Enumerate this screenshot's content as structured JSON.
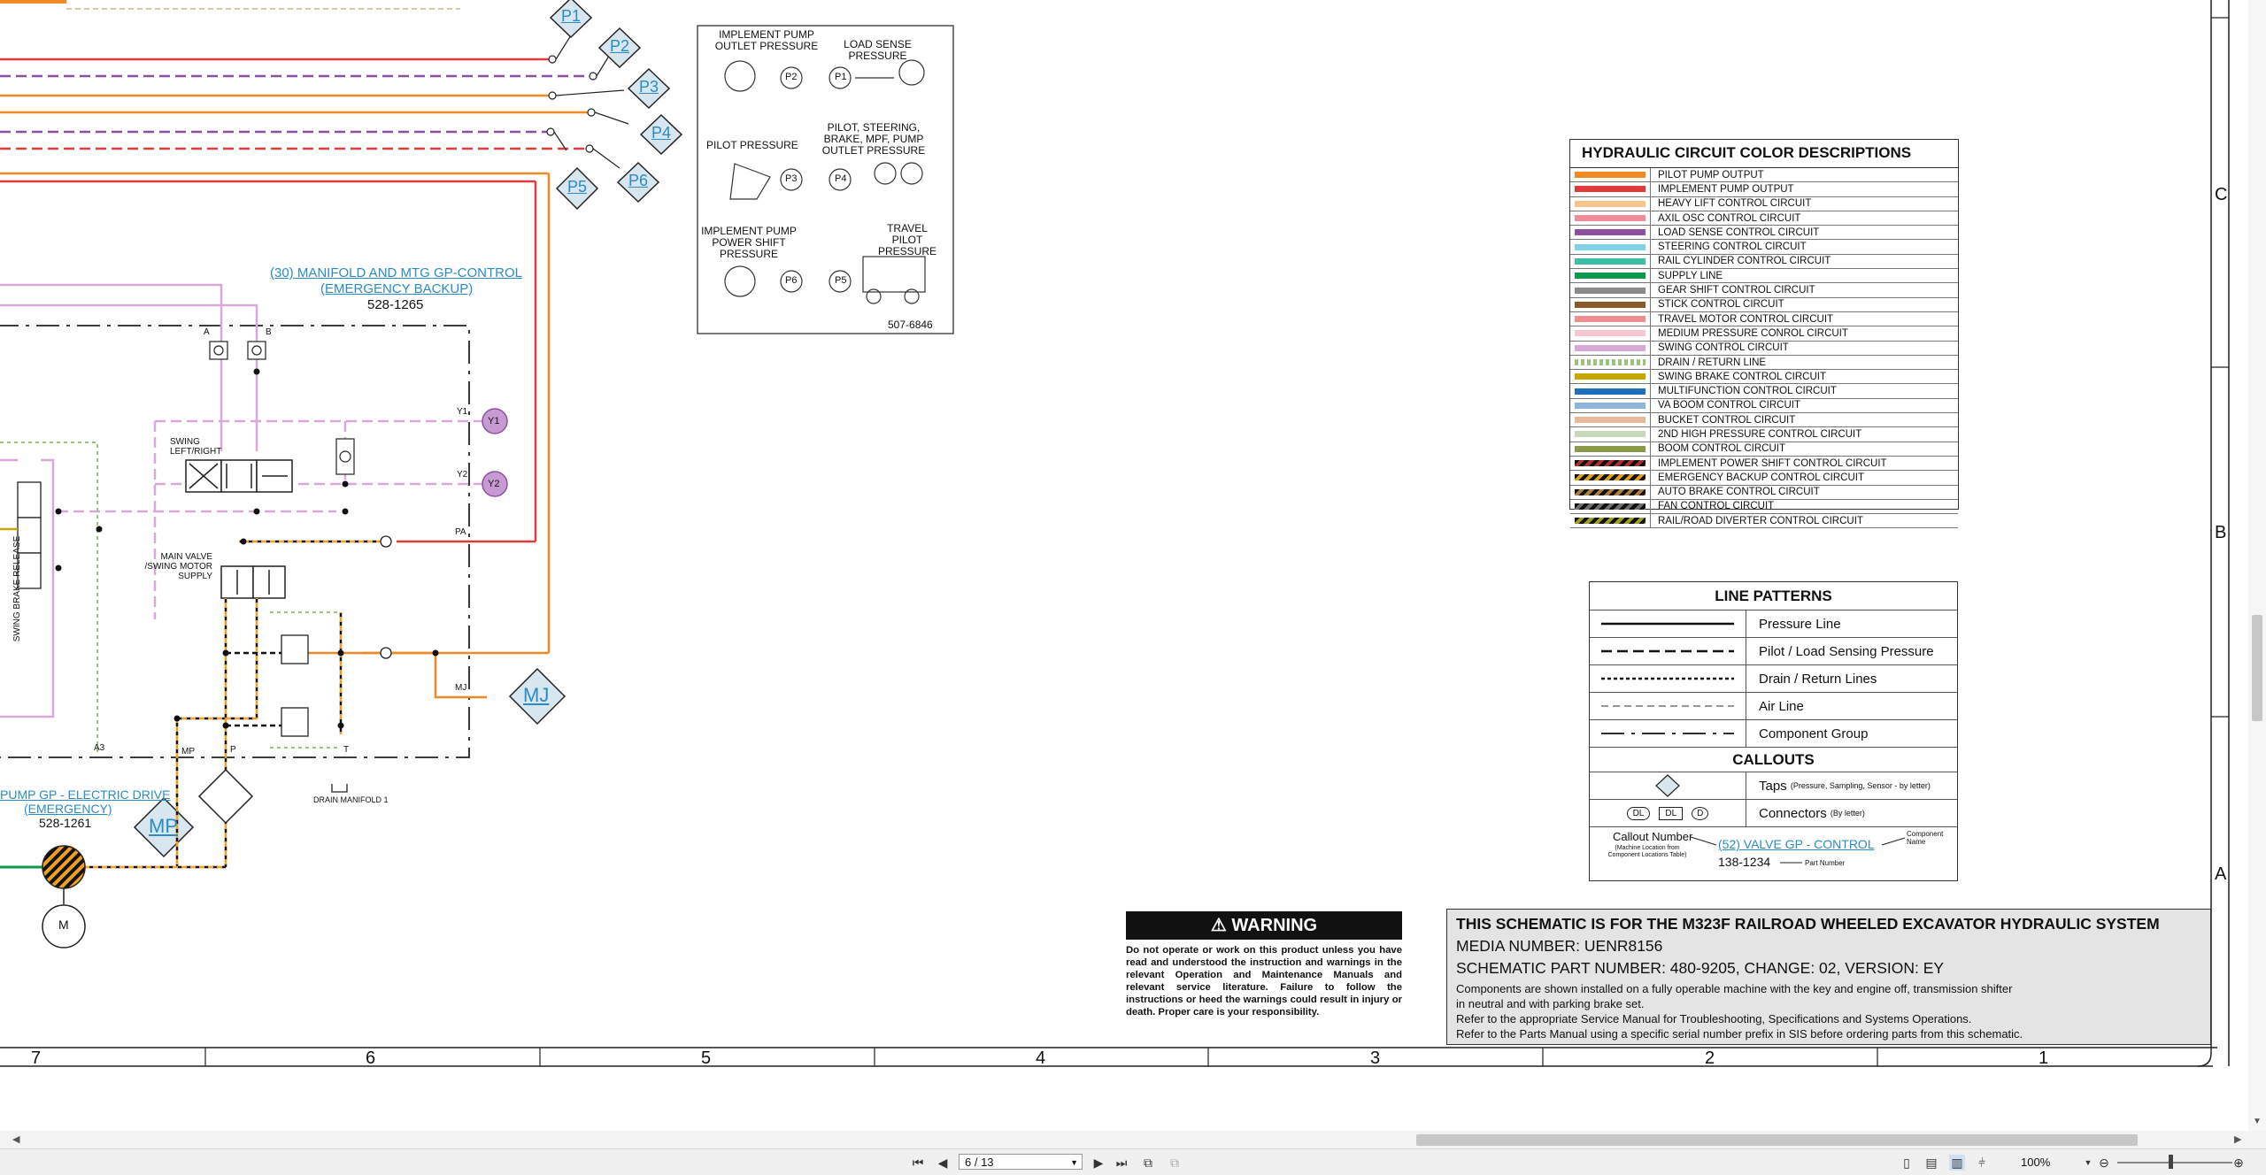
{
  "taps": {
    "p1": "P1",
    "p2": "P2",
    "p3": "P3",
    "p4": "P4",
    "p5": "P5",
    "p6": "P6",
    "mj": "MJ",
    "mp": "MP"
  },
  "pressure_key": {
    "implement_pump_outlet": "IMPLEMENT PUMP OUTLET PRESSURE",
    "load_sense": "LOAD SENSE PRESSURE",
    "pilot": "PILOT PRESSURE",
    "pilot_steering": "PILOT, STEERING, BRAKE, MPF, PUMP OUTLET PRESSURE",
    "implement_power_shift": "IMPLEMENT PUMP POWER SHIFT PRESSURE",
    "travel_pilot": "TRAVEL PILOT PRESSURE",
    "part_number": "507-6846"
  },
  "components": {
    "manifold_link_1": "(30) MANIFOLD AND MTG GP-CONTROL",
    "manifold_link_2": "(EMERGENCY BACKUP)",
    "manifold_part": "528-1265",
    "pump_link_1": "PUMP GP - ELECTRIC DRIVE",
    "pump_link_2": "(EMERGENCY)",
    "pump_part": "528-1261",
    "swing_valve": "SWING LEFT/RIGHT",
    "main_valve": "MAIN VALVE /SWING MOTOR SUPPLY",
    "swing_brake_release": "SWING BRAKE RELEASE",
    "drain_manifold": "DRAIN MANIFOLD 1",
    "motor": "M",
    "port_a": "A",
    "port_b": "B",
    "port_y1": "Y1",
    "port_y2": "Y2",
    "port_pa": "PA",
    "port_mj": "MJ",
    "port_mp": "MP",
    "port_p": "P",
    "port_t": "T",
    "port_a3": "A3"
  },
  "legend": {
    "title": "HYDRAULIC CIRCUIT COLOR DESCRIPTIONS",
    "items": [
      {
        "label": "PILOT PUMP OUTPUT",
        "color": "#f08a24"
      },
      {
        "label": "IMPLEMENT PUMP OUTPUT",
        "color": "#e03a3a"
      },
      {
        "label": "HEAVY LIFT CONTROL CIRCUIT",
        "color": "#f6c48c"
      },
      {
        "label": "AXIL OSC CONTROL CIRCUIT",
        "color": "#f28b9a"
      },
      {
        "label": "LOAD SENSE CONTROL CIRCUIT",
        "color": "#8e4fa0"
      },
      {
        "label": "STEERING CONTROL CIRCUIT",
        "color": "#7fd3e8"
      },
      {
        "label": "RAIL CYLINDER CONTROL CIRCUIT",
        "color": "#3cbfa6"
      },
      {
        "label": "SUPPLY LINE",
        "color": "#0e9a4c"
      },
      {
        "label": "GEAR SHIFT CONTROL CIRCUIT",
        "color": "#8a8a8a"
      },
      {
        "label": "STICK CONTROL CIRCUIT",
        "color": "#8b5a2b"
      },
      {
        "label": "TRAVEL MOTOR CONTROL CIRCUIT",
        "color": "#ee8f8f"
      },
      {
        "label": "MEDIUM PRESSURE CONROL CIRCUIT",
        "color": "#f7c6cf"
      },
      {
        "label": "SWING CONTROL CIRCUIT",
        "color": "#d8a8d8"
      },
      {
        "label": "DRAIN / RETURN LINE",
        "color": "#9ac47a"
      },
      {
        "label": "SWING BRAKE CONTROL CIRCUIT",
        "color": "#c8a800"
      },
      {
        "label": "MULTIFUNCTION CONTROL CIRCUIT",
        "color": "#1c6fb8"
      },
      {
        "label": "VA BOOM CONTROL CIRCUIT",
        "color": "#8fb4dc"
      },
      {
        "label": "BUCKET CONTROL CIRCUIT",
        "color": "#e8b89a"
      },
      {
        "label": "2ND HIGH PRESSURE CONTROL CIRCUIT",
        "color": "#c8d8b8"
      },
      {
        "label": "BOOM CONTROL CIRCUIT",
        "color": "#8a9a4a"
      },
      {
        "label": "IMPLEMENT POWER SHIFT CONTROL CIRCUIT",
        "color": "#b03030"
      },
      {
        "label": "EMERGENCY BACKUP CONTROL CIRCUIT",
        "color": "#e0a020"
      },
      {
        "label": "AUTO BRAKE CONTROL CIRCUIT",
        "color": "#b08040"
      },
      {
        "label": "FAN CONTROL CIRCUIT",
        "color": "#707070"
      },
      {
        "label": "RAIL/ROAD DIVERTER CONTROL CIRCUIT",
        "color": "#a0a020"
      }
    ]
  },
  "patterns": {
    "title": "LINE PATTERNS",
    "pressure": "Pressure Line",
    "pilot": "Pilot / Load Sensing Pressure",
    "drain": "Drain / Return Lines",
    "air": "Air Line",
    "group": "Component Group",
    "callouts_title": "CALLOUTS",
    "taps": "Taps",
    "taps_note": "(Pressure, Sampling, Sensor - by letter)",
    "connectors": "Connectors",
    "connectors_note": "(By letter)",
    "tap_symbol": "YY",
    "conn_dl": "DL",
    "conn_d": "D",
    "callout_number": "Callout Number",
    "callout_note": "(Machine Location from Component Locations Table)",
    "example_link": "(52) VALVE GP - CONTROL",
    "component_name": "Component Name",
    "example_part": "138-1234",
    "part_number": "Part Number"
  },
  "warning": {
    "header": "WARNING",
    "body": "Do not operate or work on this product unless you have read and understood the instruction and warnings in the relevant Operation and Maintenance Manuals and relevant service literature. Failure to follow the instructions or heed the warnings could result in injury or death. Proper care is your responsibility."
  },
  "title_block": {
    "title": "THIS SCHEMATIC IS FOR THE M323F  RAILROAD WHEELED EXCAVATOR HYDRAULIC SYSTEM",
    "media": "MEDIA NUMBER: UENR8156",
    "part": "SCHEMATIC PART NUMBER: 480-9205, CHANGE: 02, VERSION: EY",
    "note1": "Components are shown installed on a fully operable machine with the key and engine off, transmission shifter",
    "note2": "in neutral and with parking brake set.",
    "note3": "Refer to the appropriate Service Manual for Troubleshooting, Specifications and Systems Operations.",
    "note4": "Refer to the Parts Manual using a specific serial number prefix in SIS before ordering parts from this schematic."
  },
  "grid": {
    "columns": [
      "7",
      "6",
      "5",
      "4",
      "3",
      "2",
      "1"
    ],
    "rows": [
      "C",
      "B",
      "A"
    ]
  },
  "viewer": {
    "page_indicator": "6 / 13",
    "zoom": "100%"
  }
}
